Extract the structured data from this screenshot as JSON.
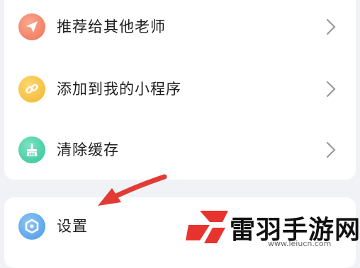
{
  "menu": {
    "items": [
      {
        "label": "推荐给其他老师",
        "icon": "paper-plane-icon",
        "color": "#f38a72"
      },
      {
        "label": "添加到我的小程序",
        "icon": "link-icon",
        "color": "#f7c544"
      },
      {
        "label": "清除缓存",
        "icon": "broom-icon",
        "color": "#49d3a8"
      }
    ]
  },
  "settings": {
    "label": "设置",
    "icon": "hexagon-gear-icon",
    "color": "#5aa7ee"
  },
  "annotation": {
    "color": "#e23b35"
  },
  "watermark": {
    "text": "雷羽手游网",
    "url": "www.leiucn.com",
    "color": "#e8342f"
  }
}
